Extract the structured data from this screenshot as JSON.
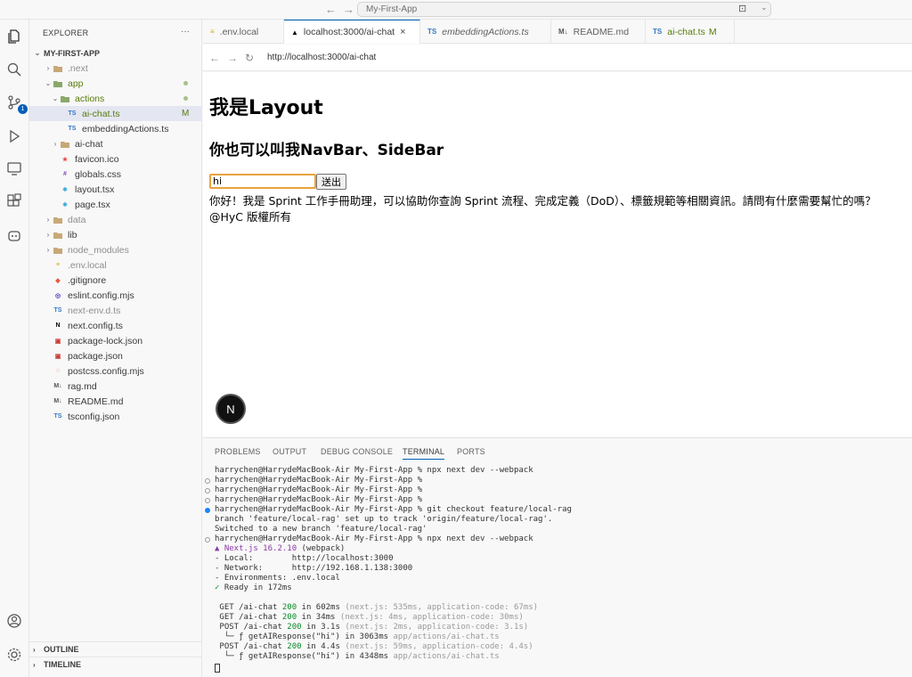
{
  "titlebar": {
    "search_text": "My-First-App"
  },
  "sidebar": {
    "header": "EXPLORER",
    "more": "···",
    "project": "MY-FIRST-APP",
    "items": [
      {
        "label": ".next",
        "depth": 1,
        "kind": "folder",
        "collapsed": true,
        "icon": "N",
        "dim": true
      },
      {
        "label": "app",
        "depth": 1,
        "kind": "folder",
        "collapsed": false,
        "icon": "",
        "git": true
      },
      {
        "label": "actions",
        "depth": 2,
        "kind": "folder",
        "collapsed": false,
        "icon": "",
        "git": true
      },
      {
        "label": "ai-chat.ts",
        "depth": 3,
        "kind": "file",
        "icon": "TS",
        "git": true,
        "mark": "M",
        "selected": true
      },
      {
        "label": "embeddingActions.ts",
        "depth": 3,
        "kind": "file",
        "icon": "TS"
      },
      {
        "label": "ai-chat",
        "depth": 2,
        "kind": "folder",
        "collapsed": true,
        "icon": ""
      },
      {
        "label": "favicon.ico",
        "depth": 2,
        "kind": "file",
        "icon": "★"
      },
      {
        "label": "globals.css",
        "depth": 2,
        "kind": "file",
        "icon": "#"
      },
      {
        "label": "layout.tsx",
        "depth": 2,
        "kind": "file",
        "icon": "⚛"
      },
      {
        "label": "page.tsx",
        "depth": 2,
        "kind": "file",
        "icon": "⚛"
      },
      {
        "label": "data",
        "depth": 1,
        "kind": "folder",
        "collapsed": true,
        "icon": "",
        "dim": true
      },
      {
        "label": "lib",
        "depth": 1,
        "kind": "folder",
        "collapsed": true,
        "icon": ""
      },
      {
        "label": "node_modules",
        "depth": 1,
        "kind": "folder",
        "collapsed": true,
        "icon": "",
        "dim": true
      },
      {
        "label": ".env.local",
        "depth": 1,
        "kind": "file",
        "icon": "≡",
        "dim": true
      },
      {
        "label": ".gitignore",
        "depth": 1,
        "kind": "file",
        "icon": "◆"
      },
      {
        "label": "eslint.config.mjs",
        "depth": 1,
        "kind": "file",
        "icon": "◎"
      },
      {
        "label": "next-env.d.ts",
        "depth": 1,
        "kind": "file",
        "icon": "TS",
        "dim": true
      },
      {
        "label": "next.config.ts",
        "depth": 1,
        "kind": "file",
        "icon": "N"
      },
      {
        "label": "package-lock.json",
        "depth": 1,
        "kind": "file",
        "icon": "▣"
      },
      {
        "label": "package.json",
        "depth": 1,
        "kind": "file",
        "icon": "▣"
      },
      {
        "label": "postcss.config.mjs",
        "depth": 1,
        "kind": "file",
        "icon": "◌"
      },
      {
        "label": "rag.md",
        "depth": 1,
        "kind": "file",
        "icon": "M↓"
      },
      {
        "label": "README.md",
        "depth": 1,
        "kind": "file",
        "icon": "M↓"
      },
      {
        "label": "tsconfig.json",
        "depth": 1,
        "kind": "file",
        "icon": "TS"
      }
    ],
    "outline": "OUTLINE",
    "timeline": "TIMELINE",
    "scm_badge": "1"
  },
  "tabs": [
    {
      "label": ".env.local",
      "icon": "≡",
      "active": false
    },
    {
      "label": "localhost:3000/ai-chat",
      "icon": "▲",
      "active": true,
      "close": "×"
    },
    {
      "label": "embeddingActions.ts",
      "icon": "TS",
      "active": false,
      "italic": true
    },
    {
      "label": "README.md",
      "icon": "M↓",
      "active": false
    },
    {
      "label": "ai-chat.ts",
      "icon": "TS",
      "active": false,
      "mark": "M"
    }
  ],
  "browser": {
    "url": "http://localhost:3000/ai-chat",
    "h1": "我是Layout",
    "h2": "你也可以叫我NavBar、SideBar",
    "input_value": "hi",
    "send_label": "送出",
    "reply": "你好！我是 Sprint 工作手冊助理，可以協助你查詢 Sprint 流程、完成定義（DoD）、標籤規範等相關資訊。請問有什麼需要幫忙的嗎？",
    "footer": "@HyC 版權所有",
    "next_badge": "N"
  },
  "panel": {
    "tabs": [
      "PROBLEMS",
      "OUTPUT",
      "DEBUG CONSOLE",
      "TERMINAL",
      "PORTS"
    ],
    "active_tab": "TERMINAL"
  },
  "terminal": {
    "prompt": "harrychen@HarrydeMacBook-Air My-First-App %",
    "lines": [
      {
        "dot": "none",
        "parts": [
          {
            "t": "harrychen@HarrydeMacBook-Air My-First-App % npx next dev --webpack"
          }
        ]
      },
      {
        "dot": "hollow",
        "parts": [
          {
            "t": "harrychen@HarrydeMacBook-Air My-First-App %"
          }
        ]
      },
      {
        "dot": "hollow",
        "parts": [
          {
            "t": "harrychen@HarrydeMacBook-Air My-First-App %"
          }
        ]
      },
      {
        "dot": "hollow",
        "parts": [
          {
            "t": "harrychen@HarrydeMacBook-Air My-First-App %"
          }
        ]
      },
      {
        "dot": "filled",
        "parts": [
          {
            "t": "harrychen@HarrydeMacBook-Air My-First-App % git checkout feature/local-rag"
          }
        ]
      },
      {
        "dot": "none",
        "parts": [
          {
            "t": "branch 'feature/local-rag' set up to track 'origin/feature/local-rag'."
          }
        ]
      },
      {
        "dot": "none",
        "parts": [
          {
            "t": "Switched to a new branch 'feature/local-rag'"
          }
        ]
      },
      {
        "dot": "hollow",
        "parts": [
          {
            "t": "harrychen@HarrydeMacBook-Air My-First-App % npx next dev --webpack"
          }
        ]
      },
      {
        "dot": "none",
        "parts": [
          {
            "t": "▲ Next.js 16.2.10",
            "c": "c-purple"
          },
          {
            "t": " (webpack)"
          }
        ]
      },
      {
        "dot": "none",
        "parts": [
          {
            "t": "- Local:        http://localhost:3000"
          }
        ]
      },
      {
        "dot": "none",
        "parts": [
          {
            "t": "- Network:      http://192.168.1.138:3000"
          }
        ]
      },
      {
        "dot": "none",
        "parts": [
          {
            "t": "- Environments: .env.local"
          }
        ]
      },
      {
        "dot": "none",
        "parts": [
          {
            "t": "✓",
            "c": "c-green"
          },
          {
            "t": " Ready in 172ms"
          }
        ]
      },
      {
        "dot": "none",
        "parts": [
          {
            "t": ""
          }
        ]
      },
      {
        "dot": "none",
        "parts": [
          {
            "t": " GET /ai-chat "
          },
          {
            "t": "200",
            "c": "c-green"
          },
          {
            "t": " in 602ms "
          },
          {
            "t": "(next.js: 535ms, application-code: 67ms)",
            "c": "c-gray"
          }
        ]
      },
      {
        "dot": "none",
        "parts": [
          {
            "t": " GET /ai-chat "
          },
          {
            "t": "200",
            "c": "c-green"
          },
          {
            "t": " in 34ms "
          },
          {
            "t": "(next.js: 4ms, application-code: 30ms)",
            "c": "c-gray"
          }
        ]
      },
      {
        "dot": "none",
        "parts": [
          {
            "t": " POST /ai-chat "
          },
          {
            "t": "200",
            "c": "c-green"
          },
          {
            "t": " in 3.1s "
          },
          {
            "t": "(next.js: 2ms, application-code: 3.1s)",
            "c": "c-gray"
          }
        ]
      },
      {
        "dot": "none",
        "parts": [
          {
            "t": "  └─ ƒ getAIResponse(\"hi\") in 3063ms "
          },
          {
            "t": "app/actions/ai-chat.ts",
            "c": "c-gray"
          }
        ]
      },
      {
        "dot": "none",
        "parts": [
          {
            "t": " POST /ai-chat "
          },
          {
            "t": "200",
            "c": "c-green"
          },
          {
            "t": " in 4.4s "
          },
          {
            "t": "(next.js: 59ms, application-code: 4.4s)",
            "c": "c-gray"
          }
        ]
      },
      {
        "dot": "none",
        "parts": [
          {
            "t": "  └─ ƒ getAIResponse(\"hi\") in 4348ms "
          },
          {
            "t": "app/actions/ai-chat.ts",
            "c": "c-gray"
          }
        ]
      }
    ]
  },
  "colors": {
    "accent": "#005fb8",
    "git_modified": "#587c0c",
    "next_purple": "#8b3aa3"
  },
  "icons": [
    "explorer-icon",
    "search-icon",
    "source-control-icon",
    "run-debug-icon",
    "remote-explorer-icon",
    "extensions-icon",
    "copilot-icon",
    "accounts-icon",
    "settings-gear-icon"
  ]
}
